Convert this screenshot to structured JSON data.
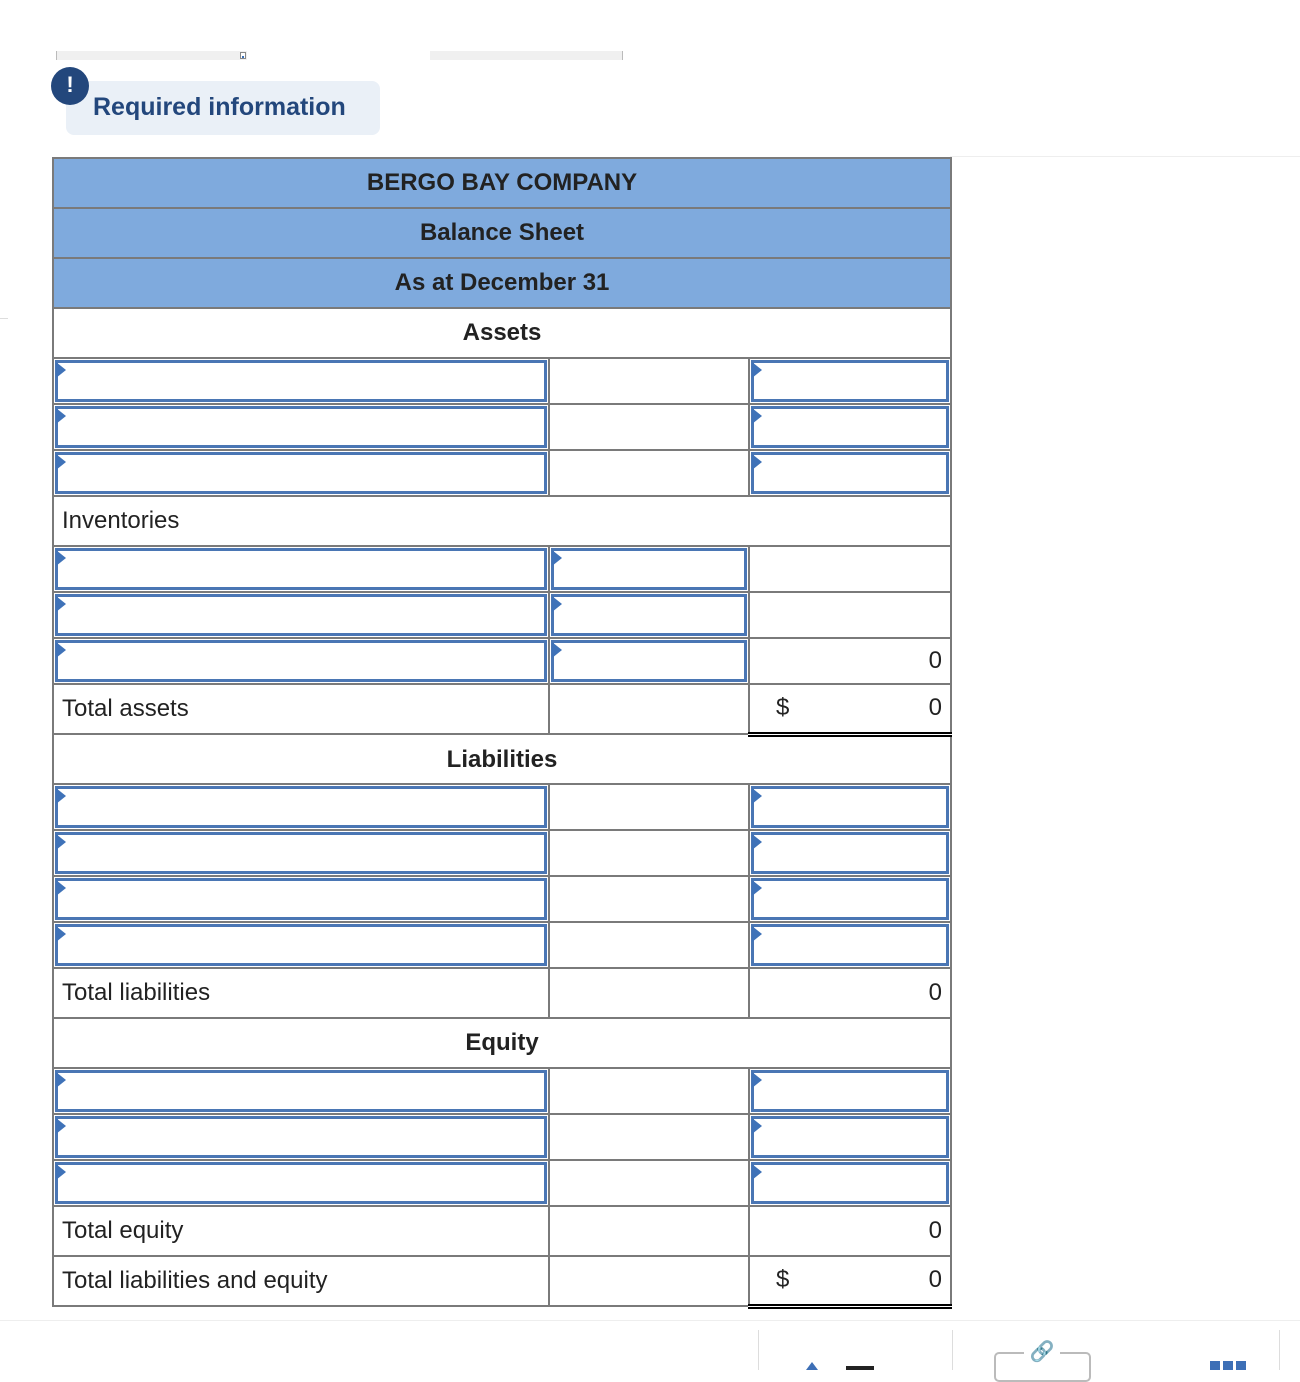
{
  "banner": {
    "badge": "!",
    "text": "Required information"
  },
  "statement": {
    "company": "BERGO BAY COMPANY",
    "title": "Balance Sheet",
    "date": "As at December 31",
    "sections": {
      "assets": "Assets",
      "liabilities": "Liabilities",
      "equity": "Equity"
    },
    "labels": {
      "inventories": "Inventories",
      "total_assets": "Total assets",
      "total_liabilities": "Total liabilities",
      "total_equity": "Total equity",
      "total_liabilities_equity": "Total liabilities and equity"
    },
    "values": {
      "inventories_subtotal": "0",
      "total_assets_symbol": "$",
      "total_assets": "0",
      "total_liabilities": "0",
      "total_equity": "0",
      "total_liabilities_equity_symbol": "$",
      "total_liabilities_equity": "0"
    }
  },
  "footer": {
    "link_icon": "🔗"
  }
}
